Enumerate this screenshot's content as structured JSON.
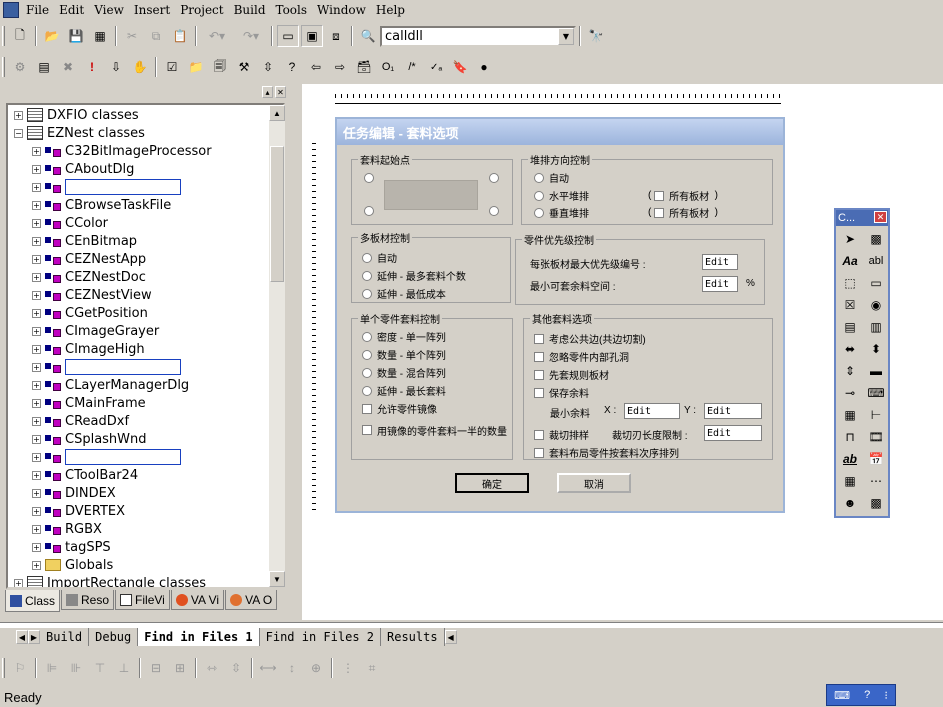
{
  "menu": [
    "File",
    "Edit",
    "View",
    "Insert",
    "Project",
    "Build",
    "Tools",
    "Window",
    "Help"
  ],
  "toolbar": {
    "combo_value": "calldll"
  },
  "tree": {
    "items": [
      {
        "label": "DXFIO classes",
        "kind": "group",
        "expander": "+"
      },
      {
        "label": "EZNest classes",
        "kind": "group",
        "expander": "-"
      },
      {
        "label": "C32BitImageProcessor",
        "kind": "class"
      },
      {
        "label": "CAboutDlg",
        "kind": "class"
      },
      {
        "label": "",
        "kind": "edit"
      },
      {
        "label": "CBrowseTaskFile",
        "kind": "class"
      },
      {
        "label": "CColor",
        "kind": "class"
      },
      {
        "label": "CEnBitmap",
        "kind": "class"
      },
      {
        "label": "CEZNestApp",
        "kind": "class"
      },
      {
        "label": "CEZNestDoc",
        "kind": "class"
      },
      {
        "label": "CEZNestView",
        "kind": "class"
      },
      {
        "label": "CGetPosition",
        "kind": "class"
      },
      {
        "label": "CImageGrayer",
        "kind": "class"
      },
      {
        "label": "CImageHigh",
        "kind": "class"
      },
      {
        "label": "",
        "kind": "edit"
      },
      {
        "label": "CLayerManagerDlg",
        "kind": "class"
      },
      {
        "label": "CMainFrame",
        "kind": "class"
      },
      {
        "label": "CReadDxf",
        "kind": "class"
      },
      {
        "label": "CSplashWnd",
        "kind": "class"
      },
      {
        "label": "",
        "kind": "edit"
      },
      {
        "label": "CToolBar24",
        "kind": "class"
      },
      {
        "label": "DINDEX",
        "kind": "class"
      },
      {
        "label": "DVERTEX",
        "kind": "class"
      },
      {
        "label": "RGBX",
        "kind": "class"
      },
      {
        "label": "tagSPS",
        "kind": "class"
      },
      {
        "label": "Globals",
        "kind": "folder"
      },
      {
        "label": "ImportRectangle classes",
        "kind": "group",
        "expander": "+"
      }
    ]
  },
  "pane_tabs": [
    "Class",
    "Reso",
    "FileVi",
    "VA Vi",
    "VA O"
  ],
  "dialog": {
    "title": "任务编辑 - 套料选项",
    "start_group": "套料起始点",
    "dir_group": "堆排方向控制",
    "dir_auto": "自动",
    "dir_h": "水平堆排",
    "dir_v": "垂直堆排",
    "all_sheets": "所有板材",
    "multi_group": "多板材控制",
    "multi_auto": "自动",
    "multi_max": "延伸 - 最多套料个数",
    "multi_cost": "延伸 - 最低成本",
    "prio_group": "零件优先级控制",
    "prio_label1": "每张板材最大优先级编号 :",
    "prio_label2": "最小可套余料空间 :",
    "prio_edit1": "Edit",
    "prio_edit2": "Edit",
    "percent": "%",
    "single_group": "单个零件套料控制",
    "single_1": "密度 - 单一阵列",
    "single_2": "数量 - 单个阵列",
    "single_3": "数量 - 混合阵列",
    "single_4": "延伸 - 最长套料",
    "single_mirror": "允许零件镜像",
    "single_half": "用镜像的零件套料一半的数量",
    "other_group": "其他套料选项",
    "other_1": "考虑公共边(共边切割)",
    "other_2": "忽略零件内部孔洞",
    "other_3": "先套规则板材",
    "other_4": "保存余料",
    "other_min": "最小余料",
    "other_x": "X :",
    "other_y": "Y :",
    "other_x_edit": "Edit",
    "other_y_edit": "Edit",
    "other_cut": "裁切排样",
    "other_cut_len": "裁切刃长度限制 :",
    "other_cut_edit": "Edit",
    "other_order": "套料布局零件按套料次序排列",
    "ok": "确定",
    "cancel": "取消"
  },
  "palette": {
    "title": "C..."
  },
  "output_tabs": [
    "Build",
    "Debug",
    "Find in Files 1",
    "Find in Files 2",
    "Results"
  ],
  "status": {
    "text": "Ready"
  }
}
